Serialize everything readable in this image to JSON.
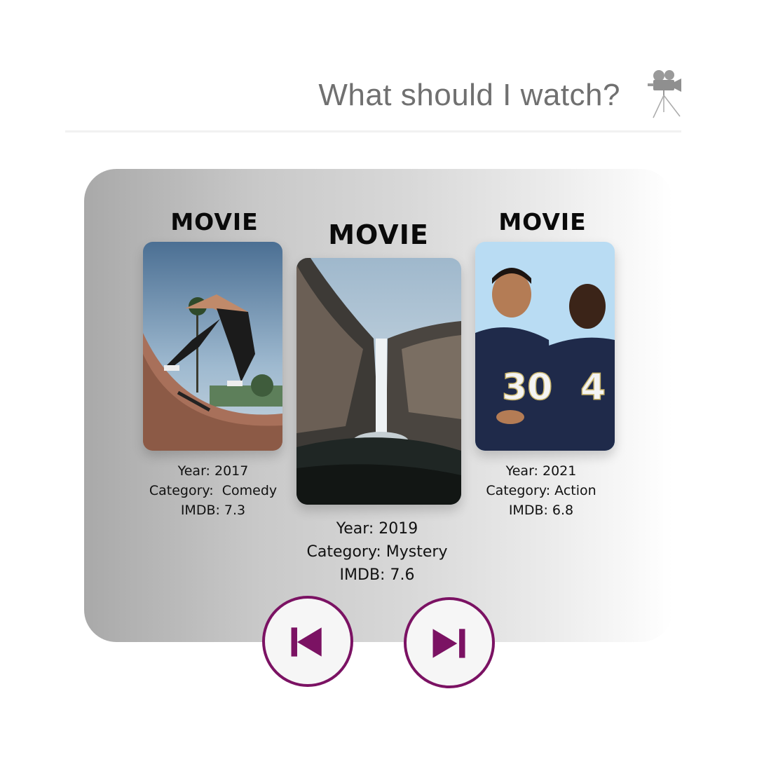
{
  "header": {
    "title": "What should I watch?",
    "icon": "movie-camera-icon"
  },
  "movies": [
    {
      "title": "MOVIE",
      "year": "Year: 2017",
      "category": "Category:  Comedy",
      "imdb": "IMDB: 7.3",
      "image": "skateboarder-photo"
    },
    {
      "title": "MOVIE",
      "year": "Year: 2019",
      "category": "Category: Mystery",
      "imdb": "IMDB: 7.6",
      "image": "waterfall-photo"
    },
    {
      "title": "MOVIE",
      "year": "Year: 2021",
      "category": "Category: Action",
      "imdb": "IMDB: 6.8",
      "image": "football-players-photo"
    }
  ],
  "controls": {
    "previous_icon": "skip-previous-icon",
    "next_icon": "skip-next-icon",
    "accent_color": "#7b1263"
  }
}
